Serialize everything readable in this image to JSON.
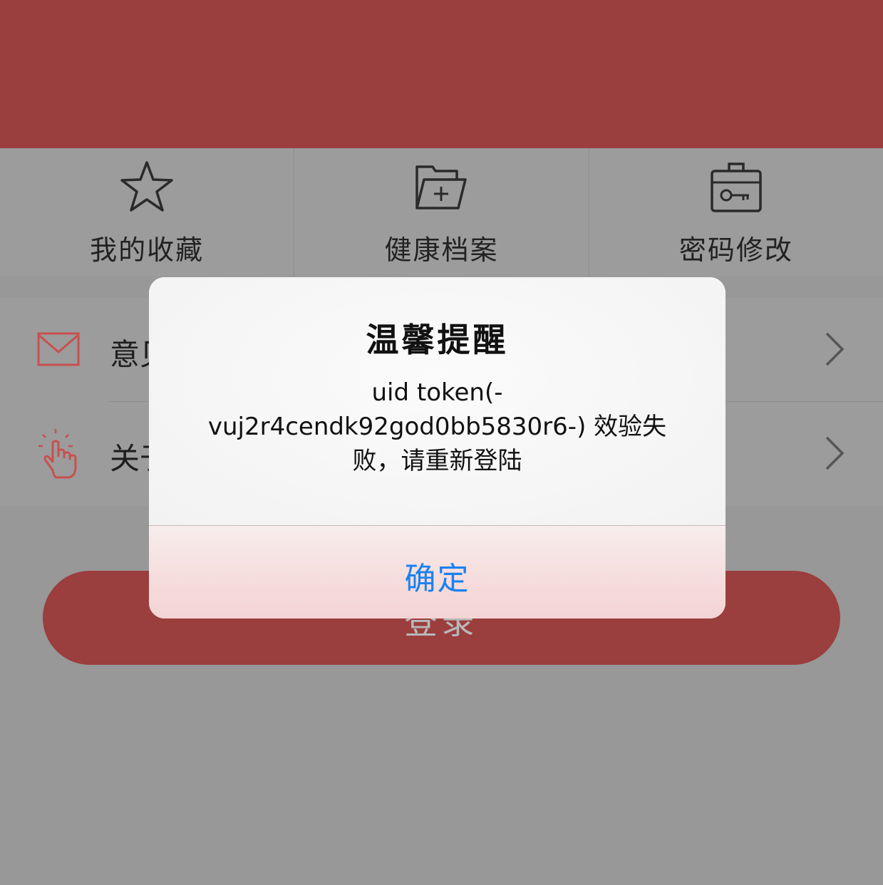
{
  "quick_actions": [
    {
      "label": "我的收藏",
      "icon": "star-icon"
    },
    {
      "label": "健康档案",
      "icon": "folder-plus-icon"
    },
    {
      "label": "密码修改",
      "icon": "key-case-icon"
    }
  ],
  "list": [
    {
      "label": "意见",
      "icon": "mail-icon"
    },
    {
      "label": "关于",
      "icon": "tap-hand-icon"
    }
  ],
  "login_button": {
    "label": "登录"
  },
  "dialog": {
    "title": "温馨提醒",
    "message_line1": "uid token(-",
    "message_line2": "vuj2r4cendk92god0bb5830r6-) 效验失",
    "message_line3": "败，请重新登陆",
    "confirm_label": "确定"
  },
  "colors": {
    "brand_red": "#9b3e3e",
    "dialog_link_blue": "#1a82f0",
    "icon_red": "#d04848"
  }
}
